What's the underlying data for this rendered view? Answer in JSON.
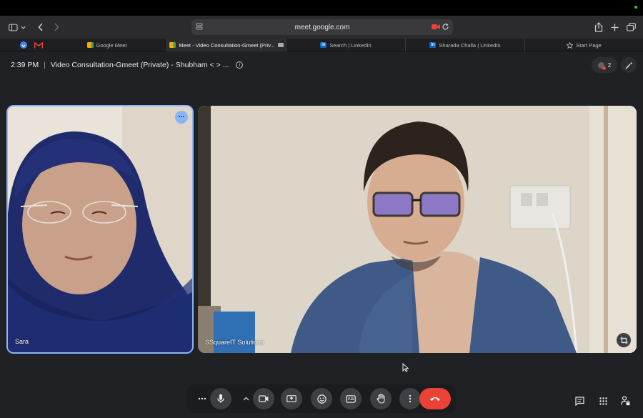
{
  "browser": {
    "url": "meet.google.com",
    "tabs": [
      {
        "label": "Google Meet",
        "favicon": "google-meet-icon",
        "active": false
      },
      {
        "label": "Meet - Video Consultation-Gmeet (Priv...",
        "favicon": "google-meet-icon",
        "active": true
      },
      {
        "label": "Search | LinkedIn",
        "favicon": "linkedin-icon",
        "active": false
      },
      {
        "label": "Sharada Challa | LinkedIn",
        "favicon": "linkedin-icon",
        "active": false
      },
      {
        "label": "Start Page",
        "favicon": "star-icon",
        "active": false
      }
    ]
  },
  "meeting": {
    "time": "2:39 PM",
    "separator": "|",
    "title": "Video Consultation-Gmeet (Private) - Shubham < > ...",
    "participant_count": "2"
  },
  "tiles": {
    "left": {
      "name": "Sara"
    },
    "main": {
      "name": "SSquareIT Solutions"
    }
  },
  "colors": {
    "meet_bg": "#202124",
    "active_speaker_border": "#8ab4f8",
    "leave_button": "#ea4335",
    "control_bg": "#3c4043"
  }
}
